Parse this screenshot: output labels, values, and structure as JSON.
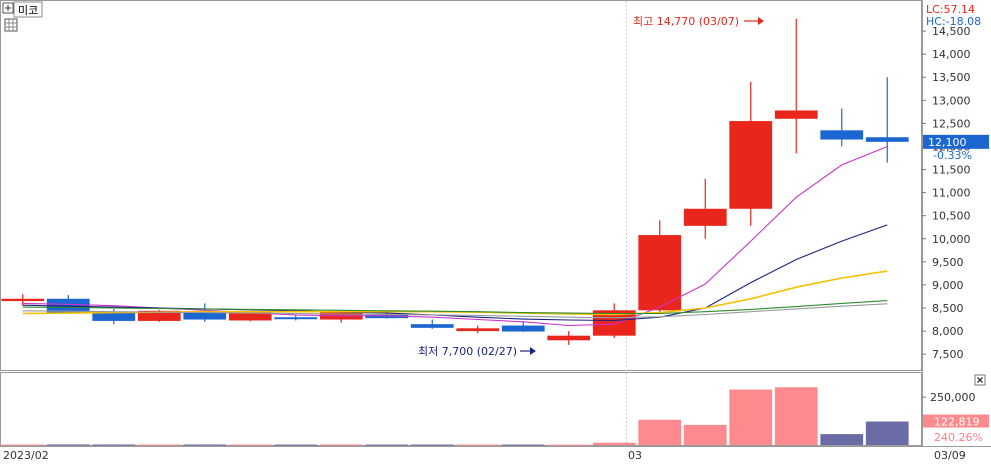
{
  "header": {
    "stock_name": "미코",
    "lc_label": "LC:57.14",
    "hc_label": "HC:-18.08"
  },
  "price_tag": {
    "price": "12,100",
    "change": "-0.33%"
  },
  "volume_tag": {
    "volume": "122,819",
    "ratio": "240.26%"
  },
  "annotations": {
    "high": "최고 14,770 (03/07)",
    "low": "최저 7,700 (02/27)"
  },
  "x_axis": {
    "start_label": "2023/02",
    "mid_label": "03",
    "end_label": "03/09"
  },
  "colors": {
    "up": "#e8261b",
    "down": "#1c66d2",
    "vol_up": "#ff8a8e",
    "vol_down": "#6b6ba6",
    "ma5": "#cc33cc",
    "ma10": "#1a237e",
    "ma20": "#f5c000",
    "ma60": "#2e8b2e",
    "ma120": "#9a9a9a"
  },
  "chart_data": {
    "type": "candlestick",
    "price_axis": {
      "ylim": [
        7200,
        15000
      ],
      "ticks": [
        {
          "value": 7500,
          "label": "7,500"
        },
        {
          "value": 8000,
          "label": "8,000"
        },
        {
          "value": 8500,
          "label": "8,500"
        },
        {
          "value": 9000,
          "label": "9,000"
        },
        {
          "value": 9500,
          "label": "9,500"
        },
        {
          "value": 10000,
          "label": "10,000"
        },
        {
          "value": 10500,
          "label": "10,500"
        },
        {
          "value": 11000,
          "label": "11,000"
        },
        {
          "value": 11500,
          "label": "11,500"
        },
        {
          "value": 12000,
          "label": "12,000"
        },
        {
          "value": 12500,
          "label": "12,500"
        },
        {
          "value": 13000,
          "label": "13,000"
        },
        {
          "value": 13500,
          "label": "13,500"
        },
        {
          "value": 14000,
          "label": "14,000"
        },
        {
          "value": 14500,
          "label": "14,500"
        }
      ]
    },
    "volume_axis": {
      "ylim": [
        0,
        340000
      ],
      "ticks": [
        {
          "value": 250000,
          "label": "250,000"
        }
      ]
    },
    "candles": [
      {
        "open": 8650,
        "high": 8800,
        "low": 8550,
        "close": 8700,
        "volume": 2500
      },
      {
        "open": 8700,
        "high": 8780,
        "low": 8380,
        "close": 8400,
        "volume": 3000
      },
      {
        "open": 8400,
        "high": 8480,
        "low": 8150,
        "close": 8220,
        "volume": 2800
      },
      {
        "open": 8220,
        "high": 8460,
        "low": 8200,
        "close": 8440,
        "volume": 2500
      },
      {
        "open": 8400,
        "high": 8600,
        "low": 8200,
        "close": 8250,
        "volume": 2800
      },
      {
        "open": 8230,
        "high": 8420,
        "low": 8210,
        "close": 8400,
        "volume": 2500
      },
      {
        "open": 8300,
        "high": 8350,
        "low": 8230,
        "close": 8270,
        "volume": 2300
      },
      {
        "open": 8250,
        "high": 8420,
        "low": 8180,
        "close": 8410,
        "volume": 2800
      },
      {
        "open": 8350,
        "high": 8400,
        "low": 8270,
        "close": 8280,
        "volume": 2300
      },
      {
        "open": 8150,
        "high": 8250,
        "low": 8050,
        "close": 8070,
        "volume": 2500
      },
      {
        "open": 8000,
        "high": 8120,
        "low": 7950,
        "close": 8060,
        "volume": 2300
      },
      {
        "open": 8120,
        "high": 8200,
        "low": 7980,
        "close": 7990,
        "volume": 2500
      },
      {
        "open": 7800,
        "high": 8000,
        "low": 7700,
        "close": 7900,
        "volume": 2000
      },
      {
        "open": 7900,
        "high": 8600,
        "low": 7850,
        "close": 8450,
        "volume": 12000
      },
      {
        "open": 8450,
        "high": 10400,
        "low": 8400,
        "close": 10080,
        "volume": 132000
      },
      {
        "open": 10280,
        "high": 11300,
        "low": 10000,
        "close": 10650,
        "volume": 105000
      },
      {
        "open": 10650,
        "high": 13400,
        "low": 10280,
        "close": 12550,
        "volume": 290000
      },
      {
        "open": 12600,
        "high": 14770,
        "low": 11850,
        "close": 12780,
        "volume": 302000
      },
      {
        "open": 12350,
        "high": 12820,
        "low": 12000,
        "close": 12150,
        "volume": 57000
      },
      {
        "open": 12200,
        "high": 13500,
        "low": 11650,
        "close": 12100,
        "volume": 122819
      }
    ],
    "moving_averages": [
      {
        "color_key": "ma5",
        "start_index": 0,
        "values": [
          8600,
          8580,
          8550,
          8500,
          8450,
          8400,
          8350,
          8330,
          8330,
          8300,
          8250,
          8200,
          8120,
          8150,
          8520,
          9020,
          9950,
          10900,
          11600,
          12000
        ]
      },
      {
        "color_key": "ma10",
        "start_index": 0,
        "values": [
          8560,
          8540,
          8520,
          8500,
          8480,
          8460,
          8440,
          8410,
          8390,
          8350,
          8300,
          8260,
          8240,
          8230,
          8300,
          8500,
          9050,
          9550,
          9950,
          10300
        ]
      },
      {
        "color_key": "ma20",
        "start_index": 0,
        "values": [
          8380,
          8390,
          8400,
          8410,
          8420,
          8420,
          8420,
          8420,
          8420,
          8420,
          8410,
          8390,
          8370,
          8360,
          8400,
          8500,
          8700,
          8950,
          9150,
          9300
        ]
      },
      {
        "color_key": "ma60",
        "start_index": 0,
        "values": [
          8520,
          8510,
          8500,
          8490,
          8480,
          8470,
          8460,
          8450,
          8440,
          8430,
          8420,
          8400,
          8390,
          8380,
          8380,
          8420,
          8470,
          8530,
          8600,
          8660
        ]
      },
      {
        "color_key": "ma120",
        "start_index": 0,
        "values": [
          8440,
          8430,
          8420,
          8410,
          8400,
          8390,
          8380,
          8370,
          8360,
          8350,
          8340,
          8320,
          8300,
          8290,
          8310,
          8360,
          8420,
          8480,
          8540,
          8590
        ]
      }
    ]
  }
}
